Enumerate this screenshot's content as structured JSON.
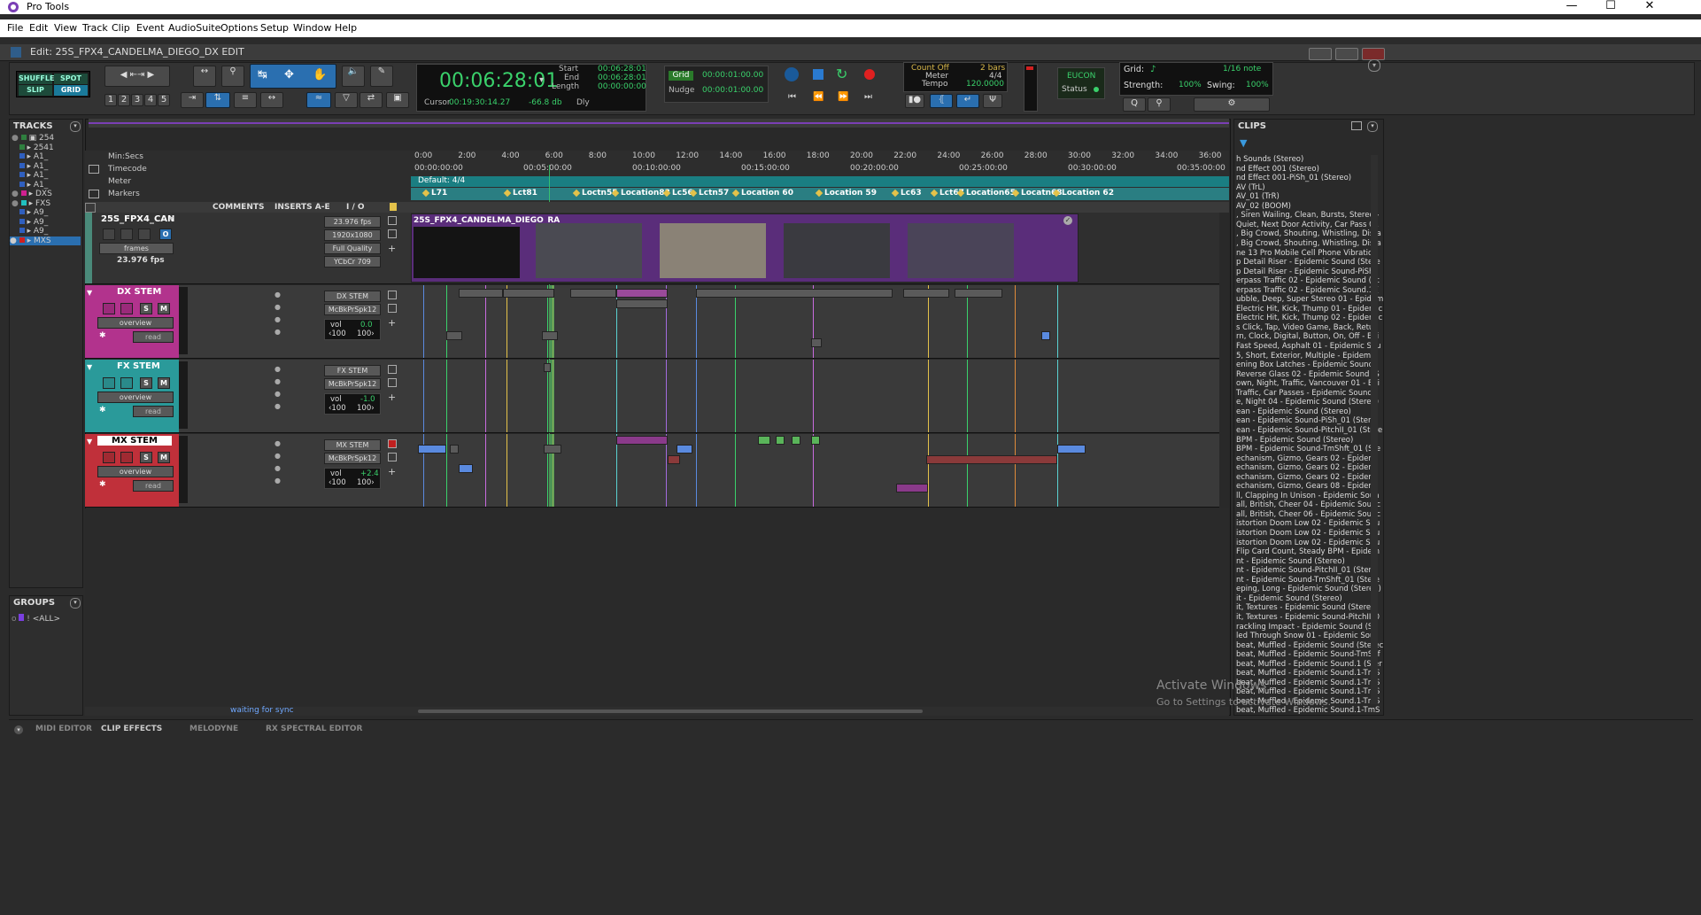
{
  "app": {
    "title": "Pro Tools"
  },
  "menu": [
    "File",
    "Edit",
    "View",
    "Track",
    "Clip",
    "Event",
    "AudioSuite",
    "Options",
    "Setup",
    "Window",
    "Help"
  ],
  "edit_window": {
    "title": "Edit: 25S_FPX4_CANDELMA_DIEGO_DX EDIT"
  },
  "toolbar": {
    "modes": {
      "shuffle": "SHUFFLE",
      "spot": "SPOT",
      "slip": "SLIP",
      "grid": "GRID"
    },
    "zoom_presets": [
      "1",
      "2",
      "3",
      "4",
      "5"
    ],
    "counter": {
      "main": "00:06:28:01",
      "start_label": "Start",
      "end_label": "End",
      "length_label": "Length",
      "start": "00:06:28:01",
      "end": "00:06:28:01",
      "length": "00:00:00:00",
      "cursor_label": "Cursor",
      "cursor": "00:19:30:14.27",
      "level": "-66.8 db",
      "dly": "Dly"
    },
    "grid": {
      "label": "Grid",
      "value": "00:00:01:00.00"
    },
    "nudge": {
      "label": "Nudge",
      "value": "00:00:01:00.00"
    },
    "midi": {
      "count_off": "Count Off",
      "bars": "2 bars",
      "meter_label": "Meter",
      "meter": "4/4",
      "tempo_label": "Tempo",
      "tempo": "120.0000"
    },
    "eucon": {
      "title": "EUCON",
      "status": "Status"
    },
    "grid_settings": {
      "grid_label": "Grid:",
      "grid_value": "1/16 note",
      "strength_label": "Strength:",
      "strength": "100%",
      "swing_label": "Swing:",
      "swing": "100%"
    }
  },
  "tracks_panel": {
    "title": "TRACKS",
    "items": [
      "254",
      "2541",
      "A1_",
      "A1_",
      "A1_",
      "A1_",
      "DXS",
      "FXS",
      "A9_",
      "A9_",
      "A9_",
      "MXS"
    ]
  },
  "groups_panel": {
    "title": "GROUPS",
    "items": [
      "<ALL>"
    ]
  },
  "rulers": {
    "minsecs_label": "Min:Secs",
    "timecode_label": "Timecode",
    "meter_label": "Meter",
    "markers_label": "Markers",
    "minsecs": [
      "0:00",
      "2:00",
      "4:00",
      "6:00",
      "8:00",
      "10:00",
      "12:00",
      "14:00",
      "16:00",
      "18:00",
      "20:00",
      "22:00",
      "24:00",
      "26:00",
      "28:00",
      "30:00",
      "32:00",
      "34:00",
      "36:00"
    ],
    "timecode": [
      "00:00:00:00",
      "00:05:00:00",
      "00:10:00:00",
      "00:15:00:00",
      "00:20:00:00",
      "00:25:00:00",
      "00:30:00:00",
      "00:35:00:00"
    ],
    "meter_value": "Default: 4/4",
    "markers": [
      "L71",
      "Lct81",
      "Loctn55",
      "Location83",
      "Lc56",
      "Lctn57",
      "Location 60",
      "Location 59",
      "Lc63",
      "Lct67",
      "Location65",
      "Locatn68",
      "Location 62"
    ]
  },
  "columns": {
    "comments": "COMMENTS",
    "inserts": "INSERTS A-E",
    "io": "I / O"
  },
  "video_track": {
    "name": "25S_FPX4_CAN",
    "fps": "23.976 fps",
    "res": "1920x1080",
    "quality": "Full Quality",
    "color": "YCbCr 709",
    "frames": "frames",
    "rate": "23.976 fps",
    "clip_name": "25S_FPX4_CANDELMA_DIEGO_RA"
  },
  "audio_tracks": [
    {
      "name": "DX STEM",
      "overview": "overview",
      "io": "DX STEM",
      "out": "McBkPrSpk12",
      "vol_label": "vol",
      "vol": "0.0",
      "pan_l": "‹100",
      "pan_r": "100›",
      "auto": "read",
      "color": "#b2338d"
    },
    {
      "name": "FX STEM",
      "overview": "overview",
      "io": "FX STEM",
      "out": "McBkPrSpk12",
      "vol_label": "vol",
      "vol": "-1.0",
      "pan_l": "‹100",
      "pan_r": "100›",
      "auto": "read",
      "color": "#2a9a9a"
    },
    {
      "name": "MX STEM",
      "overview": "overview",
      "io": "MX STEM",
      "out": "McBkPrSpk12",
      "vol_label": "vol",
      "vol": "+2.4",
      "pan_l": "‹100",
      "pan_r": "100›",
      "auto": "read",
      "color": "#c0303a"
    }
  ],
  "status": {
    "sync": "waiting for sync"
  },
  "clips_panel": {
    "title": "CLIPS",
    "items": [
      "h Sounds (Stereo)",
      "nd Effect 001 (Stereo)",
      "nd Effect 001-PiSh_01 (Stereo)",
      "AV (TrL)",
      "AV_01 (TrR)",
      "AV_02 (BOOM)",
      ", Siren Wailing, Clean, Bursts, Stereo -",
      "Quiet, Next Door Activity, Car Pass 01",
      ", Big Crowd, Shouting, Whistling, Dista",
      ", Big Crowd, Shouting, Whistling, Dista",
      "ne 13 Pro Mobile Cell Phone Vibration",
      "p Detail Riser - Epidemic Sound (Stere",
      "p Detail Riser - Epidemic Sound-PiSh",
      "erpass Traffic 02 - Epidemic Sound (St",
      "erpass Traffic 02 - Epidemic Sound.1 (",
      "ubble, Deep, Super Stereo 01 - Epidem",
      "Electric Hit, Kick, Thump 01 - Epidemic",
      "Electric Hit, Kick, Thump 02 - Epidemic",
      "s Click, Tap, Video Game, Back, Retur",
      "rn, Clock, Digital, Button, On, Off - Epi",
      "Fast Speed, Asphalt 01 - Epidemic Sou",
      "5, Short, Exterior, Multiple - Epidemic",
      "ening Box Latches - Epidemic Sound",
      "Reverse Glass 02 - Epidemic Sound (S",
      "own, Night, Traffic, Vancouver 01 - Epi",
      " Traffic, Car Passes - Epidemic Sound",
      "e, Night 04 - Epidemic Sound (Stereo)",
      "ean - Epidemic Sound (Stereo)",
      "ean - Epidemic Sound-PiSh_01 (Stere",
      "ean - Epidemic Sound-PitchII_01 (Stere",
      "BPM - Epidemic Sound (Stereo)",
      "BPM - Epidemic Sound-TmShft_01 (Ste",
      "echanism, Gizmo, Gears 02 - Epidemi",
      "echanism, Gizmo, Gears 02 - Epidemi",
      "echanism, Gizmo, Gears 02 - Epidemi",
      "echanism, Gizmo, Gears 08 - Epidemi",
      "ll, Clapping In Unison - Epidemic Soun",
      "all, British, Cheer 04 - Epidemic Sounc",
      "all, British, Cheer 06 - Epidemic Sounc",
      "istortion Doom Low 02 - Epidemic Sou",
      "istortion Doom Low 02 - Epidemic Sou",
      "istortion Doom Low 02 - Epidemic Sou",
      "Flip Card Count, Steady BPM - Epidem",
      "nt - Epidemic Sound (Stereo)",
      "nt - Epidemic Sound-PitchII_01 (Stere",
      "nt - Epidemic Sound-TmShft_01 (Stere",
      "eping, Long - Epidemic Sound (Stereo)",
      "it - Epidemic Sound (Stereo)",
      "it, Textures - Epidemic Sound (Stereo)",
      "it, Textures - Epidemic Sound-PitchII_0",
      "rackling Impact - Epidemic Sound (St",
      "led Through Snow 01 - Epidemic Sou",
      "beat, Muffled - Epidemic Sound (Sterec",
      "beat, Muffled - Epidemic Sound-TmShf",
      "beat, Muffled - Epidemic Sound.1 (Ster",
      "beat, Muffled - Epidemic Sound.1-TmS",
      "beat, Muffled - Epidemic Sound.1-TmS",
      "beat, Muffled - Epidemic Sound.1-TmS",
      "beat, Muffled - Epidemic Sound.1-TmS",
      "beat, Muffled - Epidemic Sound.1-TmS"
    ]
  },
  "bottom_tabs": [
    "MIDI EDITOR",
    "CLIP EFFECTS",
    "MELODYNE",
    "RX SPECTRAL EDITOR"
  ],
  "watermark": {
    "line1": "Activate Windows",
    "line2": "Go to Settings to activate Windows."
  }
}
